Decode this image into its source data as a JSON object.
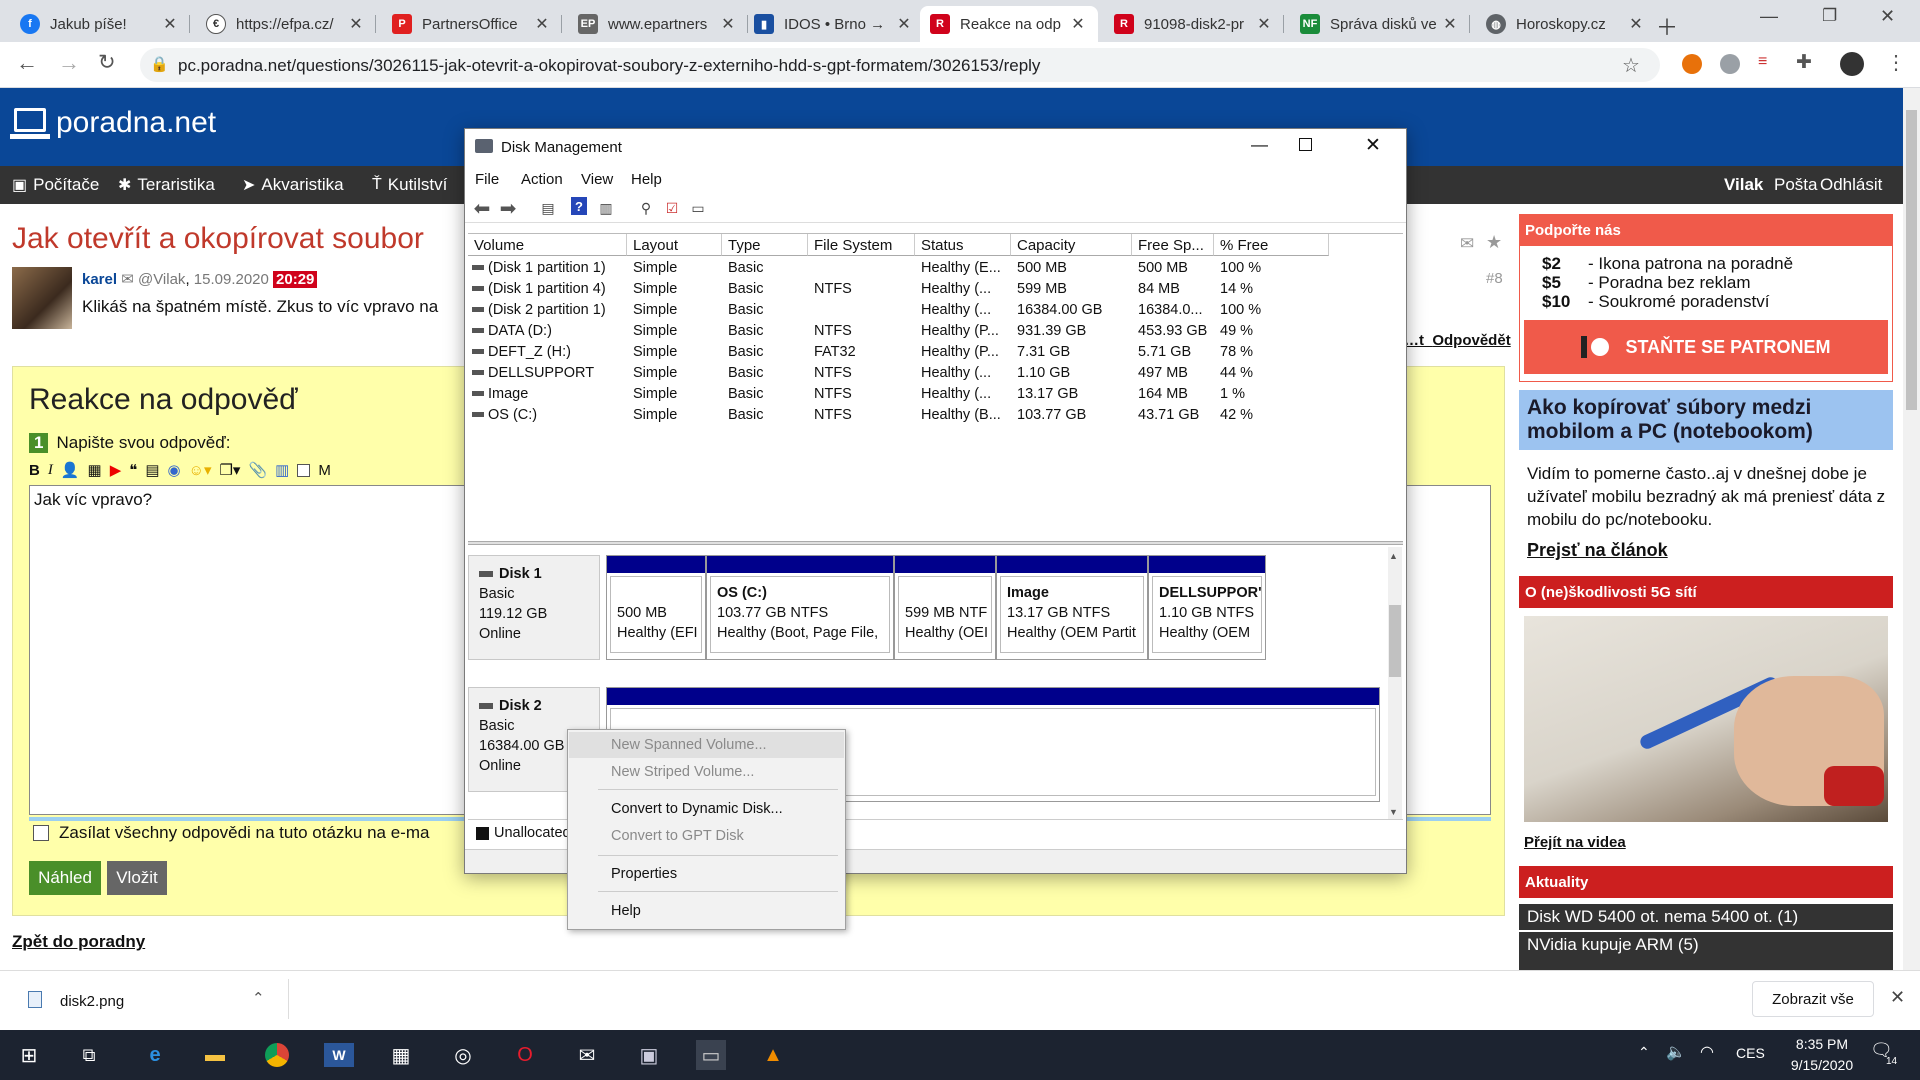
{
  "browser": {
    "tabs": [
      {
        "title": "Jakub píše!",
        "favicon": "facebook-icon",
        "color": "#1877f2"
      },
      {
        "title": "https://efpa.cz/",
        "favicon": "euro-icon",
        "color": "#333333"
      },
      {
        "title": "PartnersOffice",
        "favicon": "partners-icon",
        "color": "#e02020"
      },
      {
        "title": "www.epartners",
        "favicon": "epartners-icon",
        "color": "#666666"
      },
      {
        "title": "IDOS • Brno →",
        "favicon": "train-icon",
        "color": "#1a4fa0"
      },
      {
        "title": "Reakce na odp",
        "favicon": "poradna-icon",
        "color": "#d0021b"
      },
      {
        "title": "91098-disk2-pr",
        "favicon": "poradna-icon",
        "color": "#d0021b"
      },
      {
        "title": "Správa disků ve",
        "favicon": "nfcz-icon",
        "color": "#1a8c3a"
      },
      {
        "title": "Horoskopy.cz",
        "favicon": "globe-icon",
        "color": "#5f6368"
      }
    ],
    "active_tab": 5,
    "url": "pc.poradna.net/questions/3026115-jak-otevrit-a-okopirovat-soubory-z-externiho-hdd-s-gpt-formatem/3026153/reply"
  },
  "site": {
    "logo_text": "poradna.net",
    "nav": [
      "Počítače",
      "Teraristika",
      "Akvaristika",
      "Kutilství"
    ],
    "user": "Vilak",
    "user_links": [
      "Pošta",
      "Odhlásit"
    ]
  },
  "question": {
    "title": "Jak otevřít a okopírovat soubor",
    "author": "karel",
    "to_user": "@Vilak",
    "date": "15.09.2020",
    "time": "20:29",
    "text": "Klikáš na špatném místě. Zkus to víc vpravo na",
    "post_no": "#8",
    "links": [
      "…t",
      "Odpovědět"
    ]
  },
  "reply": {
    "heading": "Reakce na odpověď",
    "step_no": "1",
    "step_label": "Napište svou odpověď:",
    "text": "Jak víc vpravo?",
    "notify_label": "Zasílat všechny odpovědi na tuto otázku na e-ma",
    "preview_btn": "Náhled",
    "submit_btn": "Vložit",
    "back_link": "Zpět do poradny",
    "m_label": "M"
  },
  "sidebar": {
    "support": {
      "heading": "Podpořte nás",
      "items": [
        {
          "price": "$2",
          "text": "- Ikona patrona na poradně"
        },
        {
          "price": "$5",
          "text": "- Poradna bez reklam"
        },
        {
          "price": "$10",
          "text": "- Soukromé poradenství"
        }
      ],
      "patron_btn": "STAŇTE SE PATRONEM"
    },
    "article": {
      "title": "Ako kopírovať súbory medzi mobilom a PC (notebookom)",
      "text": "Vidím to pomerne často..aj v dnešnej dobe je užívateľ mobilu bezradný ak má preniesť dáta z mobilu do pc/notebooku.",
      "link": "Prejsť na článok"
    },
    "video": {
      "heading": "O (ne)škodlivosti 5G sítí",
      "link": "Přejít na videa"
    },
    "news": {
      "heading": "Aktuality",
      "items": [
        "Disk WD 5400 ot. nema 5400 ot. (1)",
        "NVidia kupuje ARM (5)"
      ]
    }
  },
  "diskmgmt": {
    "title": "Disk Management",
    "menu": [
      "File",
      "Action",
      "View",
      "Help"
    ],
    "columns": [
      "Volume",
      "Layout",
      "Type",
      "File System",
      "Status",
      "Capacity",
      "Free Sp...",
      "% Free"
    ],
    "rows": [
      [
        "(Disk 1 partition 1)",
        "Simple",
        "Basic",
        "",
        "Healthy (E...",
        "500 MB",
        "500 MB",
        "100 %"
      ],
      [
        "(Disk 1 partition 4)",
        "Simple",
        "Basic",
        "NTFS",
        "Healthy (...",
        "599 MB",
        "84 MB",
        "14 %"
      ],
      [
        "(Disk 2 partition 1)",
        "Simple",
        "Basic",
        "",
        "Healthy (...",
        "16384.00 GB",
        "16384.0...",
        "100 %"
      ],
      [
        "DATA (D:)",
        "Simple",
        "Basic",
        "NTFS",
        "Healthy (P...",
        "931.39 GB",
        "453.93 GB",
        "49 %"
      ],
      [
        "DEFT_Z (H:)",
        "Simple",
        "Basic",
        "FAT32",
        "Healthy (P...",
        "7.31 GB",
        "5.71 GB",
        "78 %"
      ],
      [
        "DELLSUPPORT",
        "Simple",
        "Basic",
        "NTFS",
        "Healthy (...",
        "1.10 GB",
        "497 MB",
        "44 %"
      ],
      [
        "Image",
        "Simple",
        "Basic",
        "NTFS",
        "Healthy (...",
        "13.17 GB",
        "164 MB",
        "1 %"
      ],
      [
        "OS (C:)",
        "Simple",
        "Basic",
        "NTFS",
        "Healthy (B...",
        "103.77 GB",
        "43.71 GB",
        "42 %"
      ]
    ],
    "disks": [
      {
        "name": "Disk 1",
        "type": "Basic",
        "size": "119.12 GB",
        "state": "Online",
        "partitions": [
          {
            "label": "",
            "line1": "500 MB",
            "line2": "Healthy (EFI"
          },
          {
            "label": "OS  (C:)",
            "line1": "103.77 GB NTFS",
            "line2": "Healthy (Boot, Page File,"
          },
          {
            "label": "",
            "line1": "599 MB NTF",
            "line2": "Healthy (OEI"
          },
          {
            "label": "Image",
            "line1": "13.17 GB NTFS",
            "line2": "Healthy (OEM Partit"
          },
          {
            "label": "DELLSUPPOR'",
            "line1": "1.10 GB NTFS",
            "line2": "Healthy (OEM"
          }
        ]
      },
      {
        "name": "Disk 2",
        "type": "Basic",
        "size": "16384.00 GB",
        "state": "Online",
        "partitions": []
      }
    ],
    "legend": "Unallocated",
    "context_menu": [
      {
        "label": "New Spanned Volume...",
        "disabled": true
      },
      {
        "label": "New Striped Volume...",
        "disabled": true
      },
      {
        "label": "Convert to Dynamic Disk...",
        "disabled": false
      },
      {
        "label": "Convert to GPT Disk",
        "disabled": true
      },
      {
        "label": "Properties",
        "disabled": false
      },
      {
        "label": "Help",
        "disabled": false
      }
    ]
  },
  "downloads": {
    "file": "disk2.png",
    "show_all": "Zobrazit vše"
  },
  "taskbar": {
    "lang": "CES",
    "time": "8:35 PM",
    "date": "9/15/2020",
    "notif_count": "14"
  }
}
